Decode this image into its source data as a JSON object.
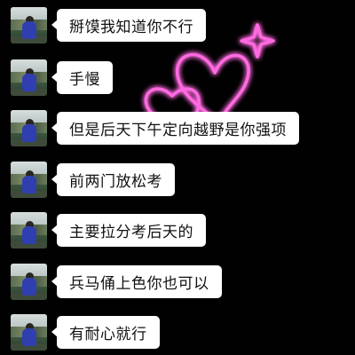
{
  "chat": {
    "messages": [
      {
        "text": "掰馍我知道你不行"
      },
      {
        "text": "手慢"
      },
      {
        "text": "但是后天下午定向越野是你强项"
      },
      {
        "text": "前两门放松考"
      },
      {
        "text": "主要拉分考后天的"
      },
      {
        "text": "兵马俑上色你也可以"
      },
      {
        "text": "有耐心就行"
      }
    ]
  },
  "decor": {
    "neon_color": "#ff4fd8",
    "icons": [
      "heart-icon",
      "heart-icon",
      "sparkle-icon"
    ]
  }
}
